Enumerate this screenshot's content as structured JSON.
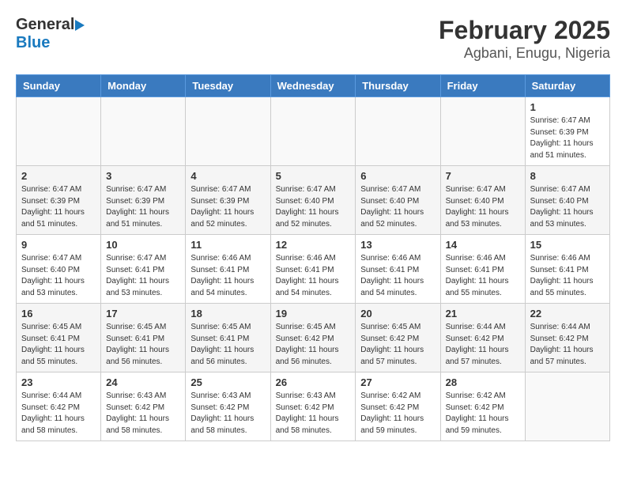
{
  "header": {
    "logo_general": "General",
    "logo_blue": "Blue",
    "title": "February 2025",
    "subtitle": "Agbani, Enugu, Nigeria"
  },
  "calendar": {
    "days_of_week": [
      "Sunday",
      "Monday",
      "Tuesday",
      "Wednesday",
      "Thursday",
      "Friday",
      "Saturday"
    ],
    "weeks": [
      [
        {
          "day": "",
          "info": ""
        },
        {
          "day": "",
          "info": ""
        },
        {
          "day": "",
          "info": ""
        },
        {
          "day": "",
          "info": ""
        },
        {
          "day": "",
          "info": ""
        },
        {
          "day": "",
          "info": ""
        },
        {
          "day": "1",
          "info": "Sunrise: 6:47 AM\nSunset: 6:39 PM\nDaylight: 11 hours\nand 51 minutes."
        }
      ],
      [
        {
          "day": "2",
          "info": "Sunrise: 6:47 AM\nSunset: 6:39 PM\nDaylight: 11 hours\nand 51 minutes."
        },
        {
          "day": "3",
          "info": "Sunrise: 6:47 AM\nSunset: 6:39 PM\nDaylight: 11 hours\nand 51 minutes."
        },
        {
          "day": "4",
          "info": "Sunrise: 6:47 AM\nSunset: 6:39 PM\nDaylight: 11 hours\nand 52 minutes."
        },
        {
          "day": "5",
          "info": "Sunrise: 6:47 AM\nSunset: 6:40 PM\nDaylight: 11 hours\nand 52 minutes."
        },
        {
          "day": "6",
          "info": "Sunrise: 6:47 AM\nSunset: 6:40 PM\nDaylight: 11 hours\nand 52 minutes."
        },
        {
          "day": "7",
          "info": "Sunrise: 6:47 AM\nSunset: 6:40 PM\nDaylight: 11 hours\nand 53 minutes."
        },
        {
          "day": "8",
          "info": "Sunrise: 6:47 AM\nSunset: 6:40 PM\nDaylight: 11 hours\nand 53 minutes."
        }
      ],
      [
        {
          "day": "9",
          "info": "Sunrise: 6:47 AM\nSunset: 6:40 PM\nDaylight: 11 hours\nand 53 minutes."
        },
        {
          "day": "10",
          "info": "Sunrise: 6:47 AM\nSunset: 6:41 PM\nDaylight: 11 hours\nand 53 minutes."
        },
        {
          "day": "11",
          "info": "Sunrise: 6:46 AM\nSunset: 6:41 PM\nDaylight: 11 hours\nand 54 minutes."
        },
        {
          "day": "12",
          "info": "Sunrise: 6:46 AM\nSunset: 6:41 PM\nDaylight: 11 hours\nand 54 minutes."
        },
        {
          "day": "13",
          "info": "Sunrise: 6:46 AM\nSunset: 6:41 PM\nDaylight: 11 hours\nand 54 minutes."
        },
        {
          "day": "14",
          "info": "Sunrise: 6:46 AM\nSunset: 6:41 PM\nDaylight: 11 hours\nand 55 minutes."
        },
        {
          "day": "15",
          "info": "Sunrise: 6:46 AM\nSunset: 6:41 PM\nDaylight: 11 hours\nand 55 minutes."
        }
      ],
      [
        {
          "day": "16",
          "info": "Sunrise: 6:45 AM\nSunset: 6:41 PM\nDaylight: 11 hours\nand 55 minutes."
        },
        {
          "day": "17",
          "info": "Sunrise: 6:45 AM\nSunset: 6:41 PM\nDaylight: 11 hours\nand 56 minutes."
        },
        {
          "day": "18",
          "info": "Sunrise: 6:45 AM\nSunset: 6:41 PM\nDaylight: 11 hours\nand 56 minutes."
        },
        {
          "day": "19",
          "info": "Sunrise: 6:45 AM\nSunset: 6:42 PM\nDaylight: 11 hours\nand 56 minutes."
        },
        {
          "day": "20",
          "info": "Sunrise: 6:45 AM\nSunset: 6:42 PM\nDaylight: 11 hours\nand 57 minutes."
        },
        {
          "day": "21",
          "info": "Sunrise: 6:44 AM\nSunset: 6:42 PM\nDaylight: 11 hours\nand 57 minutes."
        },
        {
          "day": "22",
          "info": "Sunrise: 6:44 AM\nSunset: 6:42 PM\nDaylight: 11 hours\nand 57 minutes."
        }
      ],
      [
        {
          "day": "23",
          "info": "Sunrise: 6:44 AM\nSunset: 6:42 PM\nDaylight: 11 hours\nand 58 minutes."
        },
        {
          "day": "24",
          "info": "Sunrise: 6:43 AM\nSunset: 6:42 PM\nDaylight: 11 hours\nand 58 minutes."
        },
        {
          "day": "25",
          "info": "Sunrise: 6:43 AM\nSunset: 6:42 PM\nDaylight: 11 hours\nand 58 minutes."
        },
        {
          "day": "26",
          "info": "Sunrise: 6:43 AM\nSunset: 6:42 PM\nDaylight: 11 hours\nand 58 minutes."
        },
        {
          "day": "27",
          "info": "Sunrise: 6:42 AM\nSunset: 6:42 PM\nDaylight: 11 hours\nand 59 minutes."
        },
        {
          "day": "28",
          "info": "Sunrise: 6:42 AM\nSunset: 6:42 PM\nDaylight: 11 hours\nand 59 minutes."
        },
        {
          "day": "",
          "info": ""
        }
      ]
    ]
  }
}
